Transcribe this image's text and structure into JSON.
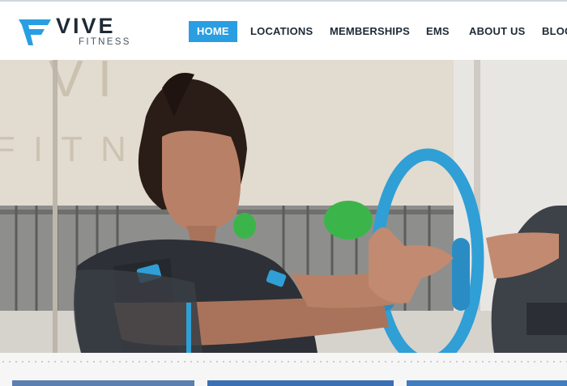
{
  "brand": {
    "name_top": "VIVE",
    "name_bottom": "FITNESS",
    "logo_icon": "vive-f-logo",
    "brand_color": "#2a9ee2",
    "text_color": "#1f2a36"
  },
  "nav": {
    "items": [
      {
        "label": "HOME",
        "active": true
      },
      {
        "label": "LOCATIONS",
        "active": false
      },
      {
        "label": "MEMBERSHIPS",
        "active": false
      },
      {
        "label": "EMS",
        "active": false
      },
      {
        "label": "ABOUT US",
        "active": false
      },
      {
        "label": "BLOG",
        "active": false
      }
    ]
  },
  "hero": {
    "image": "woman-training-with-blue-pilates-ring-in-ems-suit",
    "wall_lettering": "VIVE FITNESS"
  },
  "below": {
    "card_colors": [
      "#5b7fb0",
      "#3a6fb4",
      "#3f7cc0"
    ]
  }
}
